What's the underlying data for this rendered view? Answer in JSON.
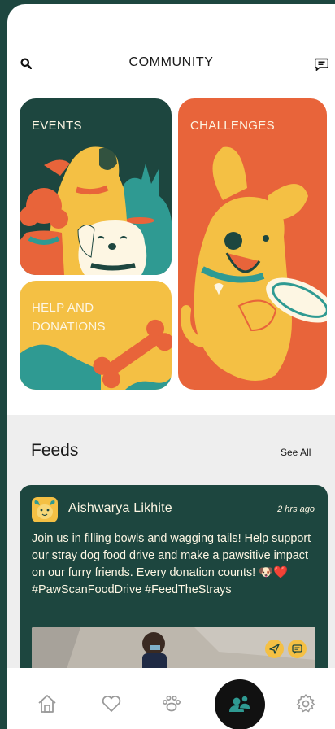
{
  "header": {
    "title": "COMMUNITY"
  },
  "tiles": {
    "events": {
      "label": "EVENTS"
    },
    "challenges": {
      "label": "CHALLENGES"
    },
    "help": {
      "label_line1": "HELP AND",
      "label_line2": "DONATIONS"
    }
  },
  "feeds": {
    "title": "Feeds",
    "see_all": "See All",
    "posts": [
      {
        "author": "Aishwarya Likhite",
        "time": "2 hrs ago",
        "body": "Join us in filling bowls and wagging tails! Help support our stray dog food drive and make a pawsitive impact on our furry friends. Every donation counts! 🐶❤️ #PawScanFoodDrive #FeedTheStrays"
      }
    ]
  },
  "nav": {
    "items": [
      "home-icon",
      "heart-icon",
      "paw-icon",
      "community-icon",
      "settings-icon"
    ]
  },
  "colors": {
    "dark_green": "#1d463f",
    "orange": "#e8643a",
    "yellow": "#f4c044",
    "cream": "#fdf6e3",
    "teal": "#2f9a92"
  }
}
